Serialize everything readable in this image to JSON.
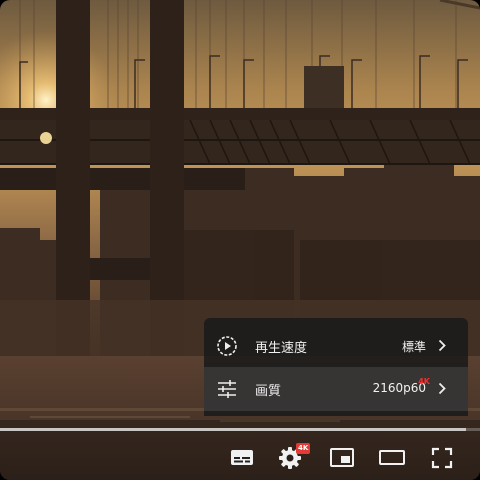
{
  "settings_menu": {
    "playback_speed": {
      "label": "再生速度",
      "value": "標準",
      "icon": "playback-speed-icon"
    },
    "quality": {
      "label": "画質",
      "value": "2160p60",
      "badge": "4K",
      "icon": "sliders-icon"
    }
  },
  "progress": {
    "played_fraction": 0.97
  },
  "controls": {
    "subtitles": "subtitles-icon",
    "settings": "gear-icon",
    "settings_badge": "4K",
    "miniplayer": "miniplayer-icon",
    "theater": "theater-mode-icon",
    "fullscreen": "fullscreen-icon"
  },
  "colors": {
    "badge_red": "#e53935",
    "menu_bg": "#1c1c1c"
  }
}
